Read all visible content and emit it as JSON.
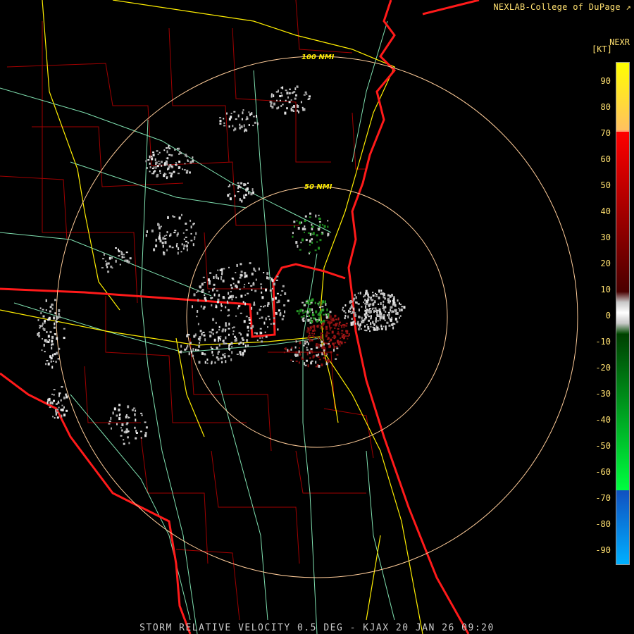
{
  "header": {
    "credit": "NEXLAB-College of DuPage",
    "credit_icon": "external-link-icon"
  },
  "legend": {
    "product": "NEXR",
    "unit": "[KT]",
    "ticks": [
      "90",
      "80",
      "70",
      "60",
      "50",
      "40",
      "30",
      "20",
      "10",
      "0",
      "-10",
      "-20",
      "-30",
      "-40",
      "-50",
      "-60",
      "-70",
      "-80",
      "-90"
    ]
  },
  "rings": [
    {
      "label": "100 NMI"
    },
    {
      "label": "50 NMI"
    }
  ],
  "colors": {
    "state_lines": "#ff1a1a",
    "county_lines": "#b00000",
    "interstates": "#ffee00",
    "highways": "#7fe0b0",
    "range_rings": "#ffcc99",
    "inbound_velocity": "#1f8f1f",
    "outbound_velocity": "#8b1010",
    "near_zero": "#c8c8c8"
  },
  "footer": {
    "text": "STORM RELATIVE VELOCITY 0.5 DEG - KJAX 20 JAN 26 09:20"
  }
}
